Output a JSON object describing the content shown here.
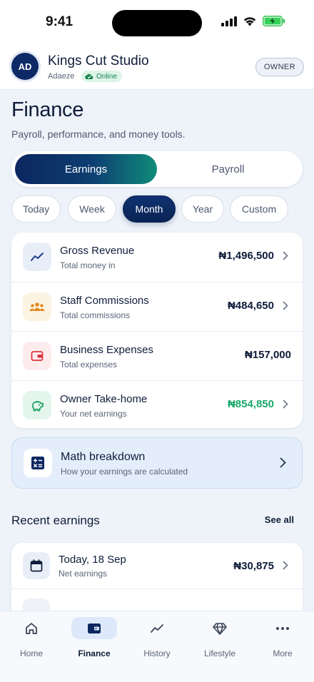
{
  "status": {
    "time": "9:41"
  },
  "header": {
    "avatar_initials": "AD",
    "business_name": "Kings Cut Studio",
    "owner_name": "Adaeze",
    "online_label": "Online",
    "role_label": "OWNER"
  },
  "page": {
    "title": "Finance",
    "subtitle": "Payroll, performance, and money tools."
  },
  "segments": {
    "active": "Earnings",
    "items": [
      "Earnings",
      "Payroll"
    ]
  },
  "filters": {
    "active": "Month",
    "items": [
      "Today",
      "Week",
      "Month",
      "Year",
      "Custom"
    ]
  },
  "summary": [
    {
      "icon": "trend-up-icon",
      "title": "Gross Revenue",
      "subtitle": "Total money in",
      "value": "₦1,496,500",
      "color": "#0f1d3a",
      "icon_bg": "#e8eef8",
      "has_chevron": true
    },
    {
      "icon": "team-icon",
      "title": "Staff Commissions",
      "subtitle": "Total commissions",
      "value": "₦484,650",
      "color": "#0f1d3a",
      "icon_bg": "#fdf3e2",
      "has_chevron": true
    },
    {
      "icon": "wallet-icon",
      "title": "Business Expenses",
      "subtitle": "Total expenses",
      "value": "₦157,000",
      "color": "#0f1d3a",
      "icon_bg": "#fdeced",
      "has_chevron": false
    },
    {
      "icon": "piggy-bank-icon",
      "title": "Owner Take-home",
      "subtitle": "Your net earnings",
      "value": "₦854,850",
      "color": "#1aa867",
      "icon_bg": "#e4f6ec",
      "has_chevron": true
    }
  ],
  "math": {
    "title": "Math breakdown",
    "subtitle": "How your earnings are calculated"
  },
  "recent": {
    "title": "Recent earnings",
    "see_all": "See all",
    "items": [
      {
        "title": "Today, 18 Sep",
        "subtitle": "Net earnings",
        "value": "₦30,875"
      }
    ]
  },
  "tabs": {
    "active": "Finance",
    "items": [
      {
        "label": "Home",
        "icon": "home-icon"
      },
      {
        "label": "Finance",
        "icon": "wallet-icon"
      },
      {
        "label": "History",
        "icon": "trend-icon"
      },
      {
        "label": "Lifestyle",
        "icon": "diamond-icon"
      },
      {
        "label": "More",
        "icon": "more-icon"
      }
    ]
  },
  "colors": {
    "navy": "#0c2660",
    "teal": "#0f8c79",
    "green": "#1aa867",
    "accent_bg": "#e4eefb"
  }
}
